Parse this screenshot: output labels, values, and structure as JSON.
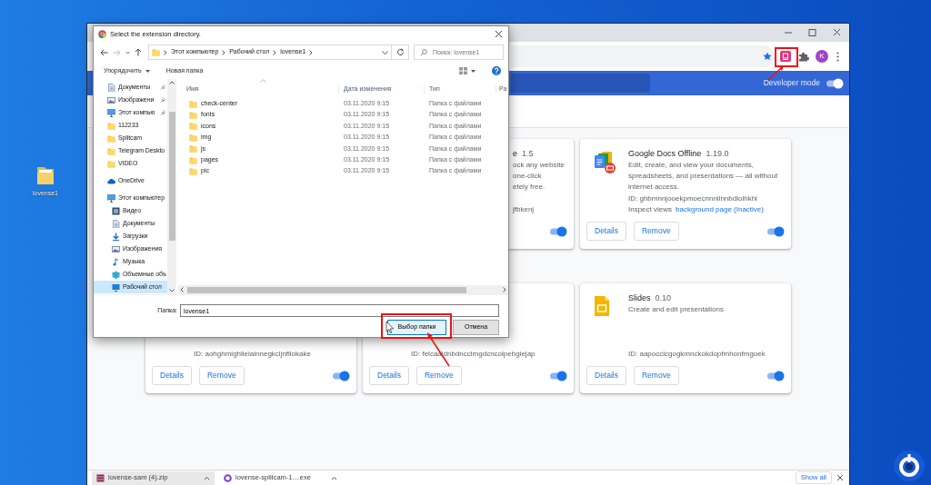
{
  "desktop": {
    "icons": [
      {
        "label": "lovense1"
      }
    ]
  },
  "browser": {
    "profile_initial": "K",
    "header": {
      "developer_mode": {
        "label": "Developer mode",
        "on": true
      }
    },
    "card_rows": [
      [
        {
          "name": "e",
          "version": "1.5",
          "description": [
            "ock any website",
            "one-click",
            "etely free."
          ],
          "id": "jfbkenj",
          "enabled": true
        },
        {
          "kind": "docs",
          "name": "Google Docs Offline",
          "version": "1.19.0",
          "description": [
            "Edit, create, and view your documents,",
            "spreadsheets, and presentations — all without",
            "internet access."
          ],
          "id": "ID: ghbmnnjooekpmoecnnnilnnbdlolhkhi",
          "inspect": {
            "label": "Inspect views",
            "link": "background page (Inactive)"
          },
          "buttons": [
            "Details",
            "Remove"
          ],
          "enabled": true
        }
      ],
      [
        {
          "id": "ID: aohghmighlieiainnegkcijnfilokake",
          "buttons": [
            "Details",
            "Remove"
          ],
          "enabled": true
        },
        {
          "id": "ID: felcaaldnbdncclmgdcncolpebgiejap",
          "buttons": [
            "Details",
            "Remove"
          ],
          "enabled": true
        },
        {
          "kind": "slides",
          "name": "Slides",
          "version": "0.10",
          "description": [
            "Create and edit presentations"
          ],
          "id": "ID: aapocclcgogkmnckokdopfmhonfmgoek",
          "buttons": [
            "Details",
            "Remove"
          ],
          "enabled": true
        }
      ]
    ],
    "downloads": {
      "items": [
        {
          "name": "lovense-sam (4).zip",
          "kind": "archive"
        },
        {
          "name": "lovense-splitcam-1....exe",
          "kind": "installer"
        }
      ],
      "show_all": "Show all"
    }
  },
  "dialog": {
    "title": "Select the extension directory.",
    "path": [
      "Этот компьютер",
      "Рабочий стол",
      "lovense1"
    ],
    "search": {
      "placeholder": "Поиск: lovense1"
    },
    "commands": [
      {
        "label": "Упорядочить",
        "menu": true
      },
      {
        "label": "Новая папка",
        "menu": false
      }
    ],
    "nav_groups": [
      [
        {
          "label": "Документы",
          "kind": "documents",
          "pinned": true,
          "selected": false
        },
        {
          "label": "Изображени",
          "kind": "pictures",
          "pinned": true,
          "selected": false
        },
        {
          "label": "Этот компью",
          "kind": "pc",
          "pinned": true,
          "selected": false
        },
        {
          "label": "112233",
          "kind": "folder",
          "pinned": false,
          "selected": false
        },
        {
          "label": "Splitcam",
          "kind": "folder",
          "pinned": false,
          "selected": false
        },
        {
          "label": "Telegram Deskto",
          "kind": "folder",
          "pinned": false,
          "selected": false
        },
        {
          "label": "VIDEO",
          "kind": "folder",
          "pinned": false,
          "selected": false
        }
      ],
      [
        {
          "label": "OneDrive",
          "kind": "cloud",
          "pinned": false,
          "selected": false
        }
      ],
      [
        {
          "label": "Этот компьютер",
          "kind": "pc",
          "pinned": false,
          "selected": false,
          "children": [
            {
              "label": "Видео",
              "kind": "video",
              "pinned": false,
              "selected": false
            },
            {
              "label": "Документы",
              "kind": "documents",
              "pinned": false,
              "selected": false
            },
            {
              "label": "Загрузки",
              "kind": "download",
              "pinned": false,
              "selected": false
            },
            {
              "label": "Изображения",
              "kind": "pictures",
              "pinned": false,
              "selected": false
            },
            {
              "label": "Музыка",
              "kind": "music",
              "pinned": false,
              "selected": false
            },
            {
              "label": "Объемные объ",
              "kind": "objects",
              "pinned": false,
              "selected": false
            },
            {
              "label": "Рабочий стол",
              "kind": "desktop",
              "pinned": false,
              "selected": true
            }
          ]
        }
      ]
    ],
    "files": {
      "columns": [
        "Имя",
        "Дата изменения",
        "Тип",
        "Ра"
      ],
      "rows": [
        {
          "name": "check-center",
          "modified": "03.11.2020 9:15",
          "type": "Папка с файлами"
        },
        {
          "name": "fonts",
          "modified": "03.11.2020 9:15",
          "type": "Папка с файлами"
        },
        {
          "name": "icons",
          "modified": "03.11.2020 9:15",
          "type": "Папка с файлами"
        },
        {
          "name": "img",
          "modified": "03.11.2020 9:15",
          "type": "Папка с файлами"
        },
        {
          "name": "js",
          "modified": "03.11.2020 9:15",
          "type": "Папка с файлами"
        },
        {
          "name": "pages",
          "modified": "03.11.2020 9:15",
          "type": "Папка с файлами"
        },
        {
          "name": "pic",
          "modified": "03.11.2020 9:15",
          "type": "Папка с файлами"
        }
      ]
    },
    "folder_label": "Папка:",
    "folder_value": "lovense1",
    "buttons": [
      {
        "label": "Выбор папки",
        "default": true
      },
      {
        "label": "Отмена",
        "default": false
      }
    ]
  }
}
